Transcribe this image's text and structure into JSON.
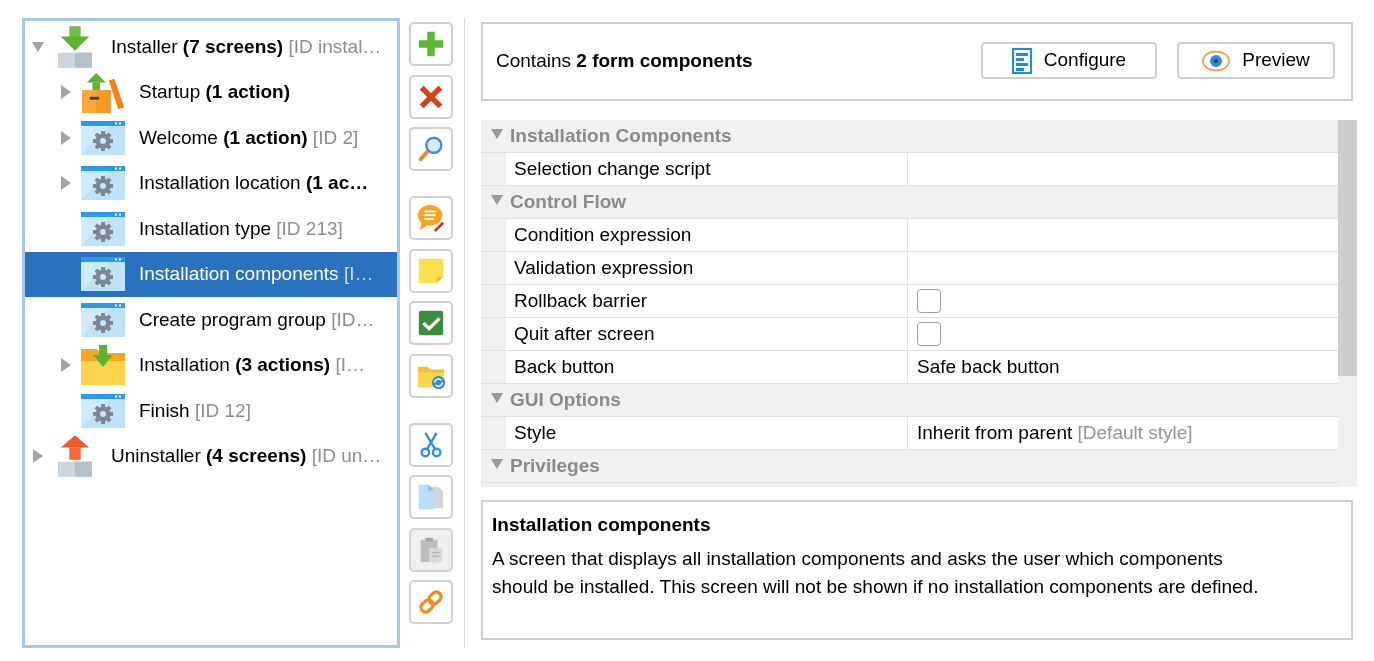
{
  "tree": {
    "items": [
      {
        "kind": "installer",
        "name": "Installer",
        "detail": "(7 screens)",
        "id": "[ID instal…",
        "expanded": true,
        "selected": false,
        "children": [
          {
            "kind": "startup",
            "name": "Startup",
            "detail": "(1 action)",
            "expanded": false,
            "selected": false
          },
          {
            "kind": "screen",
            "name": "Welcome",
            "detail": "(1 action)",
            "id": "[ID 2]",
            "expanded": false,
            "selected": false
          },
          {
            "kind": "screen",
            "name": "Installation location",
            "detail": "(1 ac…",
            "expanded": false,
            "selected": false
          },
          {
            "kind": "screen",
            "name": "Installation type",
            "id": "[ID 213]",
            "selected": false
          },
          {
            "kind": "screen",
            "name": "Installation components",
            "id": "[I…",
            "selected": true
          },
          {
            "kind": "screen",
            "name": "Create program group",
            "id": "[ID…",
            "selected": false
          },
          {
            "kind": "folder",
            "name": "Installation",
            "detail": "(3 actions)",
            "id": "[I…",
            "expanded": false,
            "selected": false
          },
          {
            "kind": "screen",
            "name": "Finish",
            "id": "[ID 12]",
            "selected": false
          }
        ]
      },
      {
        "kind": "uninstaller",
        "name": "Uninstaller",
        "detail": "(4 screens)",
        "id": "[ID un…",
        "expanded": false,
        "selected": false
      }
    ]
  },
  "toolbar": {
    "groups": [
      {
        "buttons": [
          {
            "kind": "add",
            "disabled": false
          },
          {
            "kind": "delete",
            "disabled": false
          },
          {
            "kind": "search",
            "disabled": false
          }
        ]
      },
      {
        "buttons": [
          {
            "kind": "comment",
            "disabled": false
          },
          {
            "kind": "note",
            "disabled": false
          },
          {
            "kind": "check",
            "disabled": false
          },
          {
            "kind": "folder",
            "disabled": false
          }
        ]
      },
      {
        "buttons": [
          {
            "kind": "cut",
            "disabled": false
          },
          {
            "kind": "copy",
            "disabled": false
          },
          {
            "kind": "paste",
            "disabled": true
          },
          {
            "kind": "link",
            "disabled": false
          }
        ]
      }
    ]
  },
  "summary": {
    "text": "Contains **2 form components**",
    "buttons": [
      {
        "kind": "configure",
        "label": "Configure"
      },
      {
        "kind": "preview",
        "label": "Preview"
      }
    ]
  },
  "property_grid": {
    "groups": [
      {
        "title": "Installation Components",
        "expanded": true,
        "rows": [
          {
            "name": "Selection change script",
            "kind": "text"
          }
        ]
      },
      {
        "title": "Control Flow",
        "expanded": true,
        "rows": [
          {
            "name": "Condition expression",
            "kind": "text"
          },
          {
            "name": "Validation expression",
            "kind": "text"
          },
          {
            "name": "Rollback barrier",
            "kind": "checkbox",
            "checked": false
          },
          {
            "name": "Quit after screen",
            "kind": "checkbox",
            "checked": false
          },
          {
            "name": "Back button",
            "kind": "text",
            "value": "Safe back button"
          }
        ]
      },
      {
        "title": "GUI Options",
        "expanded": true,
        "rows": [
          {
            "name": "Style",
            "kind": "text",
            "value": "Inherit from parent",
            "hint": "[Default style]"
          }
        ]
      },
      {
        "title": "Privileges",
        "expanded": true
      }
    ]
  },
  "description": {
    "title": "Installation components",
    "text": "A screen that displays all installation components and asks the user which components should be installed. This screen will not be shown if no installation components are defined."
  }
}
